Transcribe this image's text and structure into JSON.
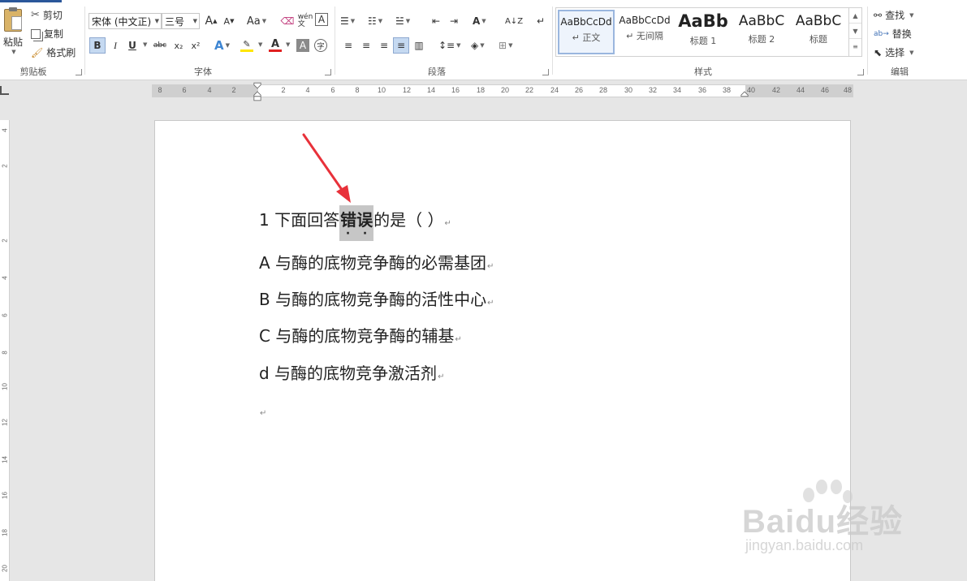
{
  "clipboard": {
    "group_label": "剪贴板",
    "paste": "粘贴",
    "cut": "剪切",
    "copy": "复制",
    "format_painter": "格式刷"
  },
  "font": {
    "group_label": "字体",
    "font_name": "宋体 (中文正)",
    "font_size": "三号",
    "bold": "B",
    "italic": "I",
    "underline": "U",
    "strikethrough": "abc",
    "subscript": "x₂",
    "superscript": "x²",
    "change_case": "Aa",
    "font_color": "#e02020",
    "highlight_color": "#ffe600"
  },
  "paragraph": {
    "group_label": "段落"
  },
  "styles": {
    "group_label": "样式",
    "items": [
      {
        "sample": "AaBbCcDd",
        "name": "↵ 正文"
      },
      {
        "sample": "AaBbCcDd",
        "name": "↵ 无间隔"
      },
      {
        "sample": "AaBb",
        "name": "标题 1"
      },
      {
        "sample": "AaBbC",
        "name": "标题 2"
      },
      {
        "sample": "AaBbC",
        "name": "标题"
      }
    ]
  },
  "editing": {
    "group_label": "编辑",
    "find": "查找",
    "replace": "替换",
    "select": "选择"
  },
  "ruler": {
    "left_ticks": [
      "8",
      "6",
      "4",
      "2"
    ],
    "right_ticks": [
      "2",
      "4",
      "6",
      "8",
      "10",
      "12",
      "14",
      "16",
      "18",
      "20",
      "22",
      "24",
      "26",
      "28",
      "30",
      "32",
      "34",
      "36",
      "38",
      "40",
      "42",
      "44",
      "46",
      "48"
    ]
  },
  "vruler": {
    "ticks": [
      "4",
      "2",
      "2",
      "4",
      "6",
      "8",
      "10",
      "12",
      "14",
      "16",
      "18",
      "20"
    ]
  },
  "document": {
    "question": {
      "prefix": "1 下面回答",
      "highlighted": "错误",
      "suffix": "的是（    ）"
    },
    "options": [
      "A 与酶的底物竞争酶的必需基团",
      "B 与酶的底物竞争酶的活性中心",
      "C 与酶的底物竞争酶的辅基",
      "d 与酶的底物竞争激活剂"
    ],
    "paragraph_mark": "↵",
    "annotation_color": "#e8313a"
  },
  "watermark": {
    "logo": "Baidu经验",
    "url": "jingyan.baidu.com"
  }
}
